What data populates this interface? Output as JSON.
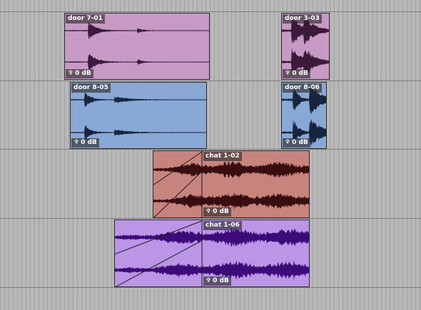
{
  "colors": {
    "lane_background": "#b8b8b8",
    "pink_clip": "#c79ac6",
    "pink_wave": "#3b1a3a",
    "blue_clip": "#8aa8d6",
    "blue_wave": "#17263e",
    "red_clip": "#c7847f",
    "red_wave": "#3a0d0f",
    "purple_clip": "#bb95e6",
    "purple_wave": "#3d0a7a"
  },
  "gain_icon": "fader-icon",
  "clips": [
    {
      "name": "door 7-01",
      "gain": "0 dB"
    },
    {
      "name": "door 3-03",
      "gain": "0 dB"
    },
    {
      "name": "door 8-05",
      "gain": "0 dB"
    },
    {
      "name": "door 8-06",
      "gain": "0 dB"
    },
    {
      "name": "chat 1-02",
      "gain": "0 dB"
    },
    {
      "name": "chat 1-06",
      "gain": "0 dB"
    }
  ]
}
